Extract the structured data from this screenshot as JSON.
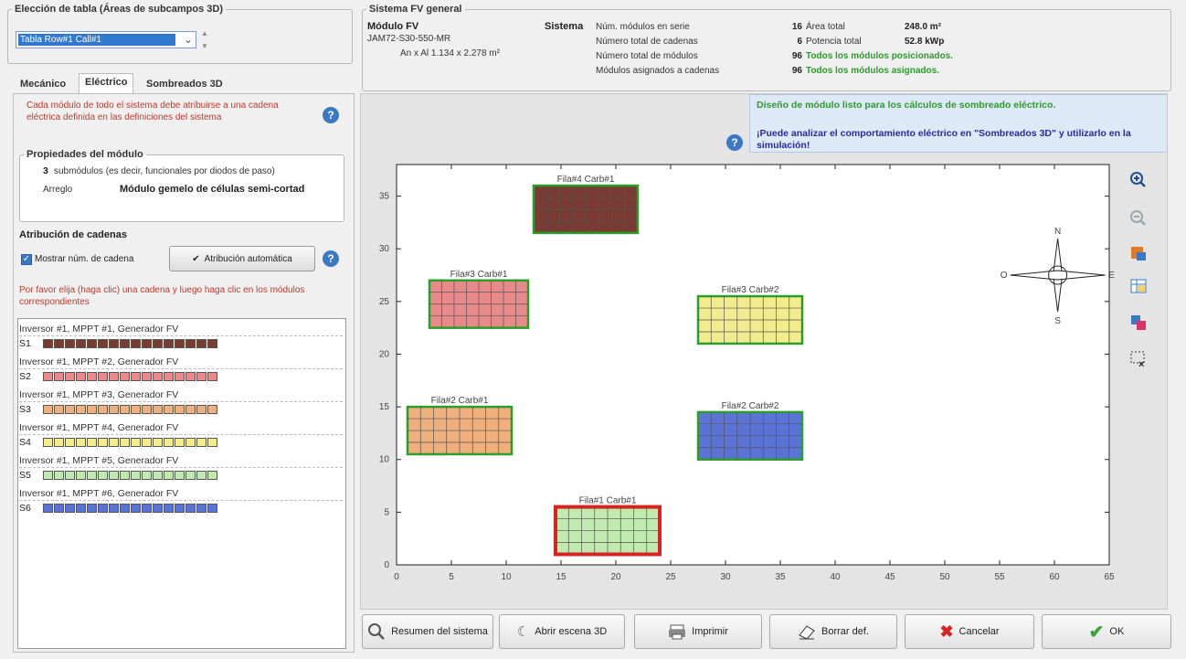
{
  "table_group": {
    "legend": "Elección de tabla  (Áreas de subcampos 3D)",
    "selected": "Tabla Row#1 Call#1"
  },
  "tabs": [
    {
      "label": "Mecánico"
    },
    {
      "label": "Eléctrico"
    },
    {
      "label": "Sombreados 3D"
    }
  ],
  "electrical": {
    "info": "Cada módulo de todo el sistema debe atribuirse a una cadena eléctrica definida en las definiciones del sistema",
    "module_props": {
      "legend": "Propiedades del módulo",
      "submodules_count": "3",
      "submodules_text": "submódulos (es decir, funcionales por diodos de paso)",
      "arrangement_label": "Arreglo",
      "arrangement_value": "Módulo gemelo de células semi-cortad"
    },
    "attribution": {
      "title": "Atribución de cadenas",
      "show_num_label": "Mostrar núm. de cadena",
      "auto_button": "Atribución automática",
      "hint": "Por favor elija (haga clic) una cadena y luego haga clic en los módulos correspondientes"
    },
    "strings": [
      {
        "label": "Inversor #1, MPPT #1, Generador FV",
        "id": "S1",
        "color": "#7a3b33"
      },
      {
        "label": "Inversor #1, MPPT #2, Generador FV",
        "id": "S2",
        "color": "#e8898a"
      },
      {
        "label": "Inversor #1, MPPT #3, Generador FV",
        "id": "S3",
        "color": "#efb07e"
      },
      {
        "label": "Inversor #1, MPPT #4, Generador FV",
        "id": "S4",
        "color": "#f2ec8e"
      },
      {
        "label": "Inversor #1, MPPT #5, Generador FV",
        "id": "S5",
        "color": "#c0eaae"
      },
      {
        "label": "Inversor #1, MPPT #6, Generador FV",
        "id": "S6",
        "color": "#5b73d6"
      }
    ]
  },
  "system": {
    "legend": "Sistema FV general",
    "module_title": "Módulo FV",
    "module_model": "JAM72-S30-550-MR",
    "module_dims": "An x Al 1.134 x 2.278 m²",
    "system_label": "Sistema",
    "rows": [
      {
        "label": "Núm. módulos en serie",
        "value": "16",
        "label2": "Área total",
        "value2": "248.0 m²"
      },
      {
        "label": "Número total de cadenas",
        "value": "6",
        "label2": "Potencia total",
        "value2": "52.8 kWp"
      },
      {
        "label": "Número total de módulos",
        "value": "96",
        "status": "Todos los módulos posicionados."
      },
      {
        "label": "Módulos asignados a cadenas",
        "value": "96",
        "status": "Todos los módulos asignados."
      }
    ]
  },
  "message": {
    "line1": "Diseño de módulo listo para los cálculos de sombreado eléctrico.",
    "line2": "¡Puede analizar el comportamiento eléctrico en \"Sombreados 3D\" y utilizarlo en la simulación!"
  },
  "compass": {
    "n": "N",
    "s": "S",
    "e": "E",
    "o": "O"
  },
  "chart_data": {
    "type": "layout",
    "xlim": [
      0,
      65
    ],
    "ylim": [
      0,
      38
    ],
    "xticks": [
      0,
      5,
      10,
      15,
      20,
      25,
      30,
      35,
      40,
      45,
      50,
      55,
      60,
      65
    ],
    "yticks": [
      0,
      5,
      10,
      15,
      20,
      25,
      30,
      35
    ],
    "tables": [
      {
        "name": "Fila#4 Carb#1",
        "x0": 12.5,
        "x1": 22,
        "y0": 31.5,
        "y1": 36,
        "fill": "#7a3b33",
        "border": "#2aa02a"
      },
      {
        "name": "Fila#3 Carb#1",
        "x0": 3,
        "x1": 12,
        "y0": 22.5,
        "y1": 27,
        "fill": "#e8898a",
        "border": "#2aa02a"
      },
      {
        "name": "Fila#3 Carb#2",
        "x0": 27.5,
        "x1": 37,
        "y0": 21,
        "y1": 25.5,
        "fill": "#f2ec8e",
        "border": "#2aa02a"
      },
      {
        "name": "Fila#2 Carb#1",
        "x0": 1,
        "x1": 10.5,
        "y0": 10.5,
        "y1": 15,
        "fill": "#efb07e",
        "border": "#2aa02a"
      },
      {
        "name": "Fila#2 Carb#2",
        "x0": 27.5,
        "x1": 37,
        "y0": 10,
        "y1": 14.5,
        "fill": "#5b73d6",
        "border": "#2aa02a"
      },
      {
        "name": "Fila#1 Carb#1",
        "x0": 14.5,
        "x1": 24,
        "y0": 1,
        "y1": 5.5,
        "fill": "#c0eaae",
        "border": "#d92323"
      }
    ]
  },
  "footer": {
    "summary": "Resumen del sistema",
    "scene": "Abrir escena 3D",
    "print": "Imprimir",
    "delete": "Borrar def.",
    "cancel": "Cancelar",
    "ok": "OK"
  }
}
